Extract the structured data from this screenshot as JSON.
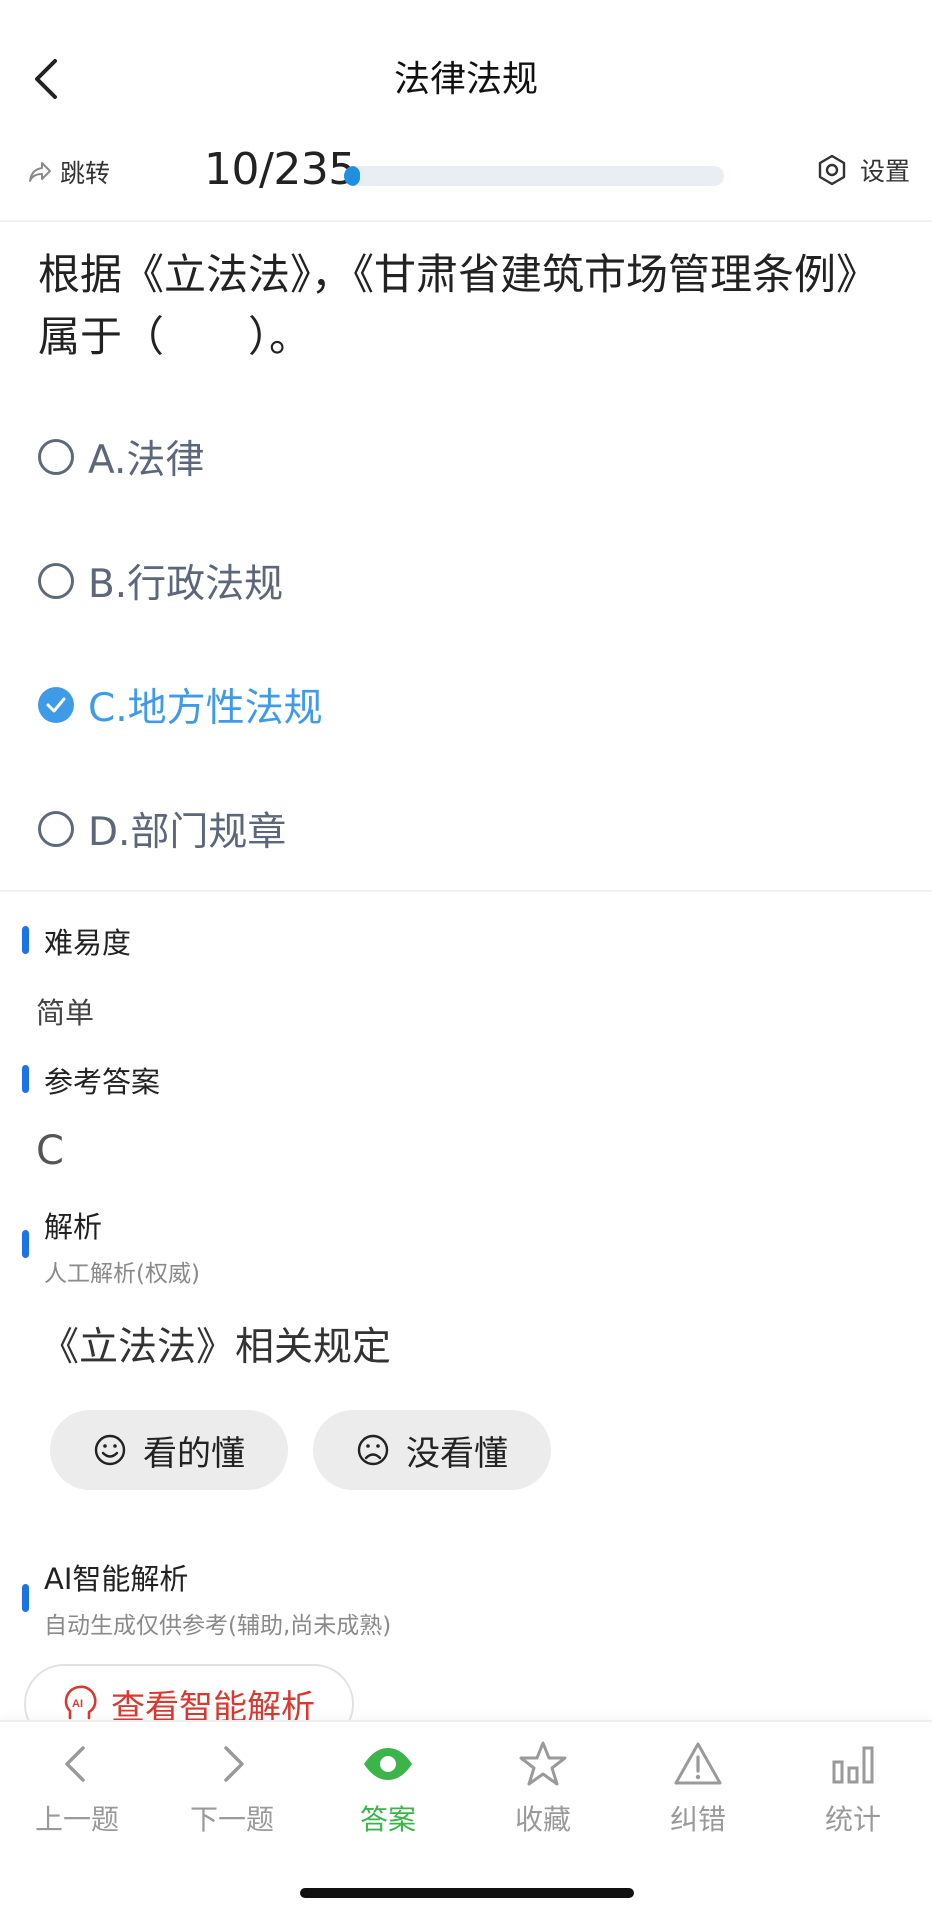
{
  "header": {
    "title": "法律法规"
  },
  "toolbar": {
    "jump_label": "跳转",
    "progress_text": "10/235",
    "progress_fraction": 0.0426,
    "settings_label": "设置"
  },
  "question": {
    "text": "根据《立法法》，《甘肃省建筑市场管理条例》属于（　　）。",
    "options": [
      {
        "label": "A.法律",
        "selected": false
      },
      {
        "label": "B.行政法规",
        "selected": false
      },
      {
        "label": "C.地方性法规",
        "selected": true
      },
      {
        "label": "D.部门规章",
        "selected": false
      }
    ]
  },
  "difficulty": {
    "title": "难易度",
    "value": "简单"
  },
  "answer": {
    "title": "参考答案",
    "value": "C"
  },
  "explanation": {
    "title": "解析",
    "subtitle": "人工解析(权威)",
    "text": "《立法法》相关规定",
    "understood_label": "看的懂",
    "not_understood_label": "没看懂"
  },
  "ai_explanation": {
    "title": "AI智能解析",
    "subtitle": "自动生成仅供参考(辅助,尚未成熟)",
    "button_label": "查看智能解析"
  },
  "bottom_nav": {
    "items": [
      {
        "label": "上一题",
        "icon": "chevron-left-icon",
        "active": false
      },
      {
        "label": "下一题",
        "icon": "chevron-right-icon",
        "active": false
      },
      {
        "label": "答案",
        "icon": "eye-icon",
        "active": true
      },
      {
        "label": "收藏",
        "icon": "star-icon",
        "active": false
      },
      {
        "label": "纠错",
        "icon": "warning-icon",
        "active": false
      },
      {
        "label": "统计",
        "icon": "bar-chart-icon",
        "active": false
      }
    ]
  },
  "colors": {
    "accent_blue": "#3f9be8",
    "progress_blue": "#1e8fe1",
    "section_bar": "#1a73e8",
    "active_green": "#3bb54a",
    "ai_red": "#d63a30"
  }
}
